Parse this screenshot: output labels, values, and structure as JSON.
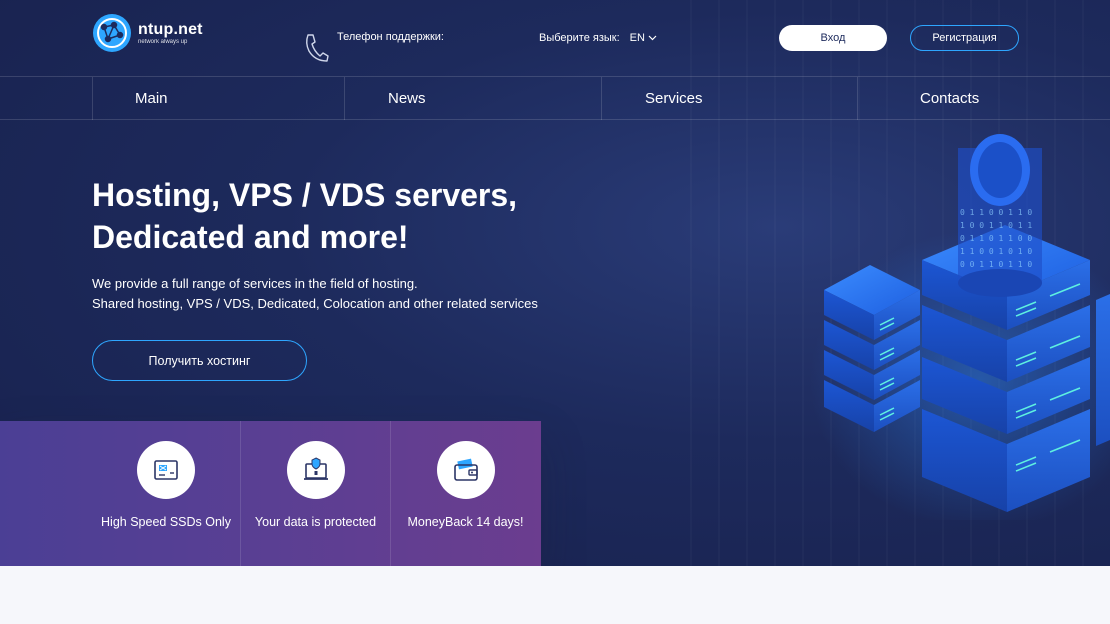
{
  "brand": {
    "name": "ntup.net",
    "tagline": "network always up"
  },
  "header": {
    "phone_label": "Телефон поддержки:",
    "language_label": "Выберите язык:",
    "language_value": "EN",
    "login_label": "Вход",
    "register_label": "Регистрация"
  },
  "nav": {
    "items": [
      {
        "label": "Main"
      },
      {
        "label": "News"
      },
      {
        "label": "Services"
      },
      {
        "label": "Contacts"
      }
    ]
  },
  "hero": {
    "title_line1": "Hosting, VPS / VDS servers,",
    "title_line2": "Dedicated and more!",
    "subtitle_line1": "We provide a full range of services in the field of hosting.",
    "subtitle_line2": "Shared hosting, VPS / VDS, Dedicated, Colocation and other related services",
    "cta_label": "Получить хостинг"
  },
  "features": [
    {
      "label": "High Speed SSDs Only",
      "icon": "ssd-icon"
    },
    {
      "label": "Your data is protected",
      "icon": "protected-data-icon"
    },
    {
      "label": "MoneyBack 14 days!",
      "icon": "wallet-icon"
    }
  ],
  "colors": {
    "hero_bg": "#1d2a5c",
    "accent": "#2ea6ff",
    "features_start": "#4b3f95",
    "features_end": "#6b3d8f"
  }
}
